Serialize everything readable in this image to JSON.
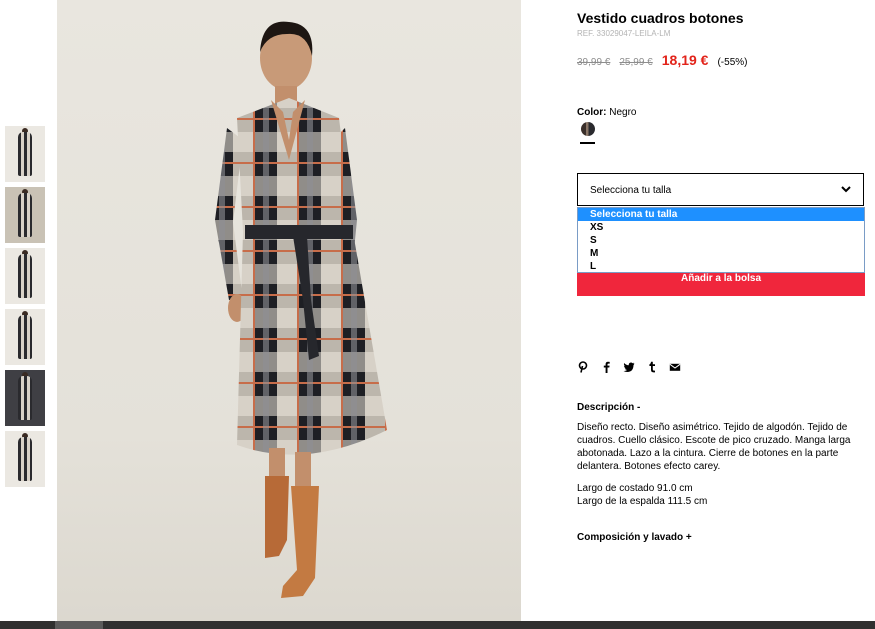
{
  "product": {
    "title": "Vestido cuadros botones",
    "ref": "REF. 33029047-LEILA-LM",
    "price_original_1": "39,99 €",
    "price_original_2": "25,99 €",
    "price_sale": "18,19 €",
    "discount": "(-55%)"
  },
  "color": {
    "label": "Color:",
    "value": "Negro"
  },
  "size": {
    "selected": "Selecciona tu talla",
    "options": [
      "Selecciona tu talla",
      "XS",
      "S",
      "M",
      "L"
    ]
  },
  "add_button": "Añadir a la bolsa",
  "share_icons": [
    "pinterest-icon",
    "facebook-icon",
    "twitter-icon",
    "tumblr-icon",
    "mail-icon"
  ],
  "description": {
    "heading": "Descripción -",
    "text": "Diseño recto. Diseño asimétrico. Tejido de algodón. Tejido de cuadros. Cuello clásico. Escote de pico cruzado. Manga larga abotonada. Lazo a la cintura. Cierre de botones en la parte delantera. Botones efecto carey.",
    "measure_1": "Largo de costado 91.0 cm",
    "measure_2": "Largo de la espalda 111.5 cm"
  },
  "composition_heading": "Composición y lavado +"
}
